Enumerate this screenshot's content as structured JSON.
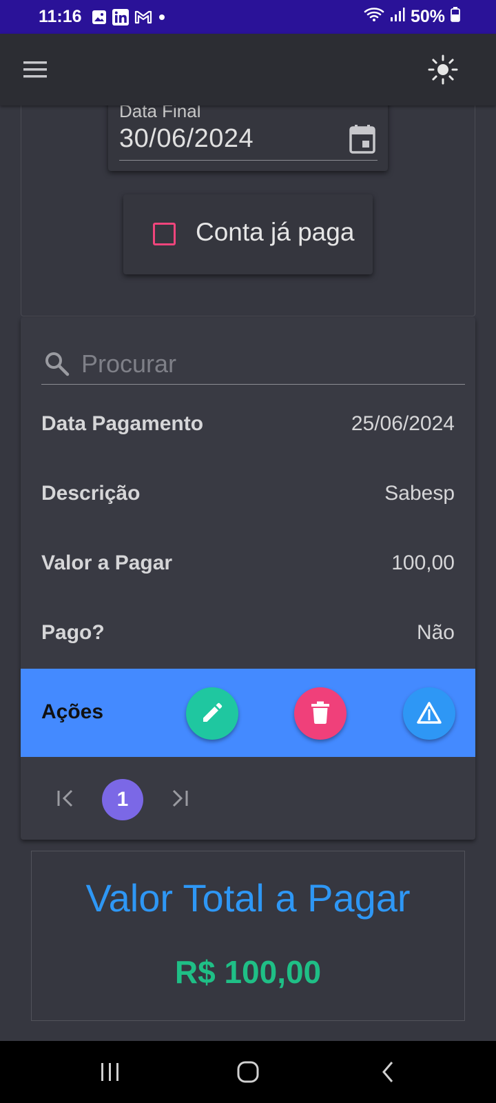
{
  "status_bar": {
    "time": "11:16",
    "battery": "50%",
    "icons": [
      "image-icon",
      "linkedin-icon",
      "gmail-icon",
      "dot-icon",
      "wifi-icon",
      "signal-icon",
      "battery-icon"
    ]
  },
  "app_bar": {
    "menu_icon": "menu-icon",
    "theme_icon": "sun-icon"
  },
  "filters": {
    "end_date_label": "Data Final",
    "end_date_value": "30/06/2024",
    "paid_checkbox_label": "Conta já paga",
    "paid_checked": false
  },
  "search": {
    "placeholder": "Procurar",
    "value": ""
  },
  "record": {
    "rows": [
      {
        "label": "Data Pagamento",
        "value": "25/06/2024"
      },
      {
        "label": "Descrição",
        "value": "Sabesp"
      },
      {
        "label": "Valor a Pagar",
        "value": "100,00"
      },
      {
        "label": "Pago?",
        "value": "Não"
      }
    ],
    "actions_label": "Ações"
  },
  "pagination": {
    "current_page": "1"
  },
  "total": {
    "title": "Valor Total a Pagar",
    "value": "R$ 100,00"
  },
  "colors": {
    "status_bar": "#2a1298",
    "accent_blue": "#448aff",
    "edit": "#1fc7a0",
    "delete": "#f0407a",
    "alert": "#2e97f5",
    "page_active": "#7b68e6",
    "total_value": "#1fbf86"
  }
}
